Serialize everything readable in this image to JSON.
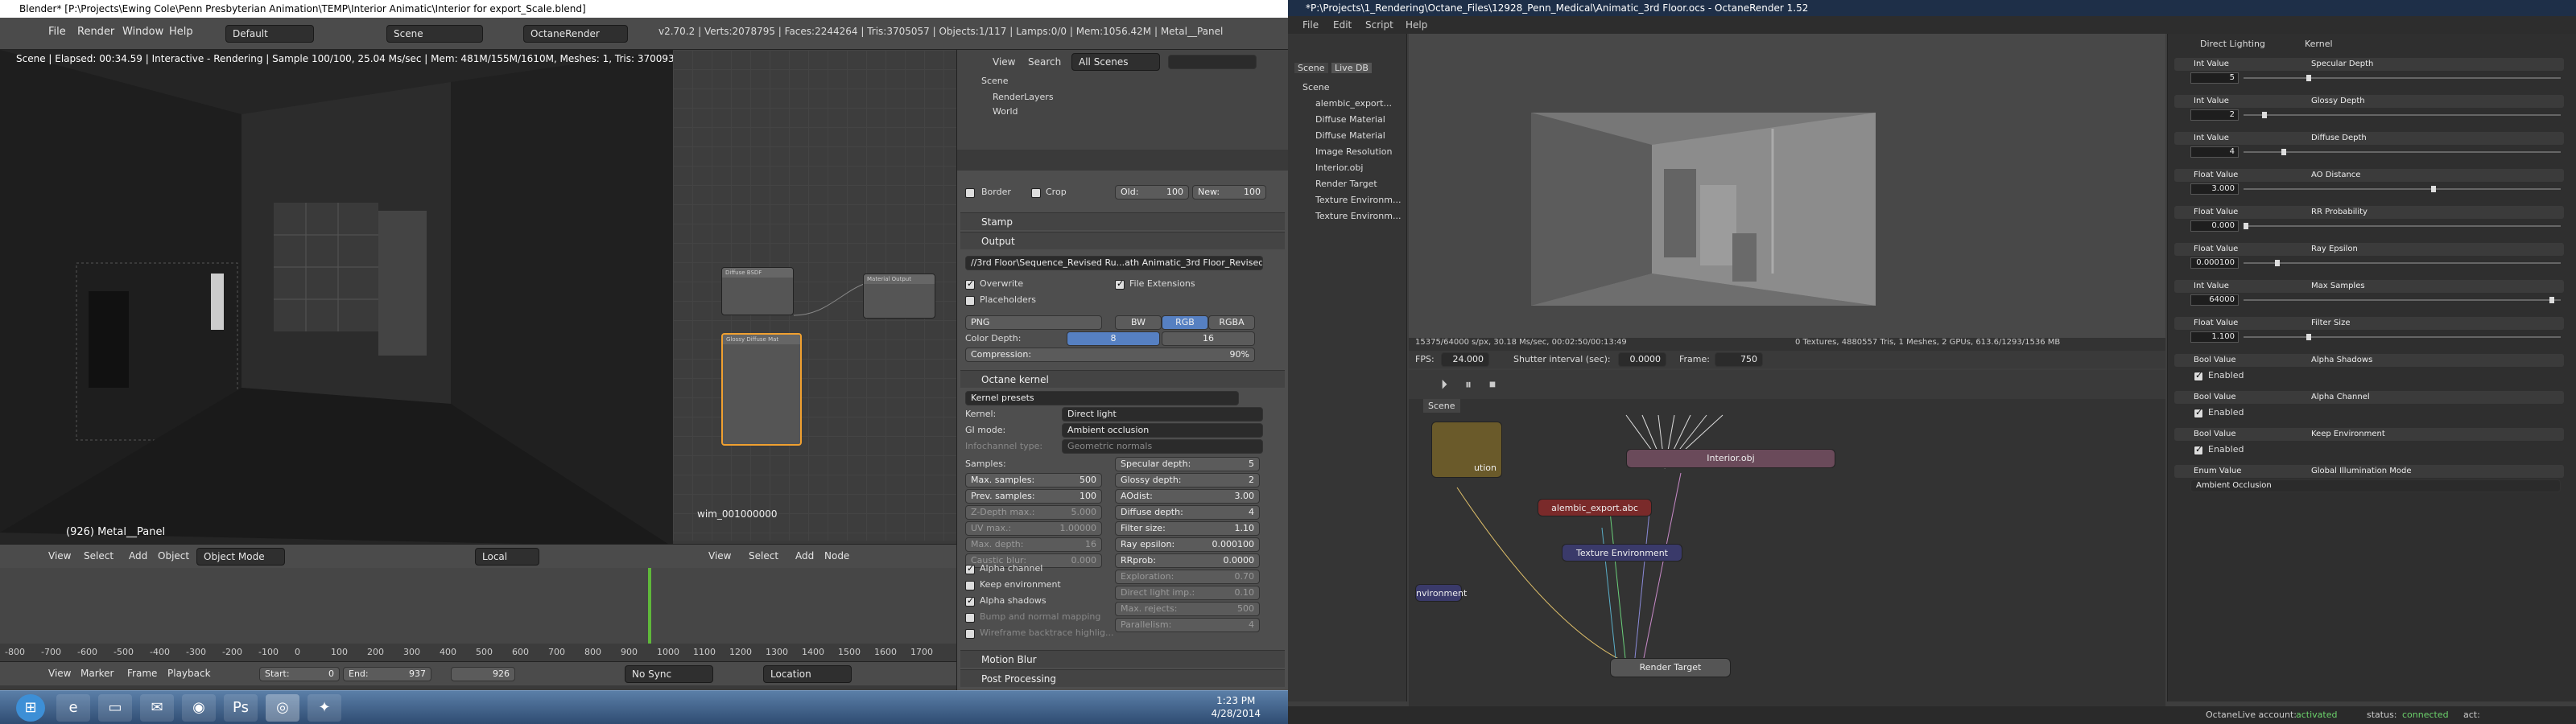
{
  "blender": {
    "title": "Blender* [P:\\Projects\\Ewing Cole\\Penn Presbyterian Animation\\TEMP\\Interior Animatic\\Interior for export_Scale.blend]",
    "menus": [
      "File",
      "Render",
      "Window",
      "Help"
    ],
    "layout": "Default",
    "scene": "Scene",
    "engine": "OctaneRender",
    "stats": "v2.70.2 | Verts:2078795 | Faces:2244264 | Tris:3705057 | Objects:1/117 | Lamps:0/0 | Mem:1056.42M | Metal__Panel",
    "viewport": {
      "status": "Scene | Elapsed: 00:34.59 | Interactive - Rendering | Sample 100/100, 25.04 Ms/sec | Mem: 481M/155M/1610M, Meshes: 1, Tris: 3700931 | Tex: ( Rgb32: 0/4, Rg",
      "object_label": "(926) Metal__Panel",
      "menus": [
        "View",
        "Select",
        "Add",
        "Object"
      ],
      "mode": "Object Mode",
      "pivot": "Local"
    },
    "node_editor": {
      "label": "wim_001000000",
      "menus": [
        "View",
        "Select",
        "Add",
        "Node"
      ],
      "nodes": [
        "Diffuse BSDF",
        "Glossy Diffuse Mat",
        "Material Output"
      ]
    },
    "timeline": {
      "menus": [
        "View",
        "Marker",
        "Frame",
        "Playback"
      ],
      "start_label": "Start:",
      "start": "0",
      "end_label": "End:",
      "end": "937",
      "current": "926",
      "sync": "No Sync",
      "keying": "Location",
      "ticks": [
        "-800",
        "-700",
        "-600",
        "-500",
        "-400",
        "-300",
        "-200",
        "-100",
        "0",
        "100",
        "200",
        "300",
        "400",
        "500",
        "600",
        "700",
        "800",
        "900",
        "1000",
        "1100",
        "1200",
        "1300",
        "1400",
        "1500",
        "1600",
        "1700"
      ]
    },
    "outliner": {
      "menus": [
        "View",
        "Search"
      ],
      "filter": "All Scenes",
      "items": [
        "Scene",
        "RenderLayers",
        "World"
      ]
    },
    "properties": {
      "border_label": "Border",
      "crop_label": "Crop",
      "old_label": "Old:",
      "old": "100",
      "new_label": "New:",
      "new": "100",
      "stamp": "Stamp",
      "output": "Output",
      "path": "//3rd Floor\\Sequence_Revised Ru...ath Animatic_3rd Floor_Revised_",
      "overwrite": "Overwrite",
      "file_ext": "File Extensions",
      "placeholders": "Placeholders",
      "format": "PNG",
      "bw": "BW",
      "rgb": "RGB",
      "rgba": "RGBA",
      "color_depth_label": "Color Depth:",
      "depth8": "8",
      "depth16": "16",
      "compression_label": "Compression:",
      "compression": "90%",
      "octane_kernel": "Octane kernel",
      "kernel_presets": "Kernel presets",
      "kernel_label": "Kernel:",
      "kernel": "Direct light",
      "gimode_label": "GI mode:",
      "gimode": "Ambient occlusion",
      "infochannel_label": "Infochannel type:",
      "infochannel": "Geometric normals",
      "samples_label": "Samples:",
      "left_fields": [
        {
          "k": "Max. samples:",
          "v": "500"
        },
        {
          "k": "Prev. samples:",
          "v": "100"
        },
        {
          "k": "Z-Depth max.:",
          "v": "5.000"
        },
        {
          "k": "UV max.:",
          "v": "1.00000"
        },
        {
          "k": "Max. depth:",
          "v": "16"
        },
        {
          "k": "Caustic blur:",
          "v": "0.000"
        }
      ],
      "right_fields": [
        {
          "k": "Specular depth:",
          "v": "5"
        },
        {
          "k": "Glossy depth:",
          "v": "2"
        },
        {
          "k": "AOdist:",
          "v": "3.00"
        },
        {
          "k": "Diffuse depth:",
          "v": "4"
        },
        {
          "k": "Filter size:",
          "v": "1.10"
        },
        {
          "k": "Ray epsilon:",
          "v": "0.000100"
        },
        {
          "k": "RRprob:",
          "v": "0.0000"
        },
        {
          "k": "Exploration:",
          "v": "0.70"
        },
        {
          "k": "Direct light imp.:",
          "v": "0.10"
        },
        {
          "k": "Max. rejects:",
          "v": "500"
        },
        {
          "k": "Parallelism:",
          "v": "4"
        }
      ],
      "alpha_channel": "Alpha channel",
      "keep_env": "Keep environment",
      "alpha_shadows": "Alpha shadows",
      "bump": "Bump and normal mapping",
      "wireframe": "Wireframe backtrace highlig...",
      "motion_blur": "Motion Blur",
      "post_processing": "Post Processing"
    },
    "taskbar": {
      "time": "1:23 PM",
      "date": "4/28/2014",
      "icons": [
        "start-orb-icon",
        "ie-icon",
        "folder-icon",
        "outlook-icon",
        "firefox-icon",
        "photoshop-icon",
        "blender-icon",
        "octane-icon"
      ]
    }
  },
  "octane": {
    "title": "*P:\\Projects\\1_Rendering\\Octane_Files\\12928_Penn_Medical\\Animatic_3rd Floor.ocs - OctaneRender 1.52",
    "menus": [
      "File",
      "Edit",
      "Script",
      "Help"
    ],
    "outliner_tabs": [
      "Scene",
      "Live DB"
    ],
    "outliner_items": [
      "Scene",
      "alembic_export...",
      "Diffuse Material",
      "Diffuse Material",
      "Image Resolution",
      "Interior.obj",
      "Render Target",
      "Texture Environm...",
      "Texture Environm..."
    ],
    "status": "15375/64000 s/px, 30.18 Ms/sec, 00:02:50/00:13:49",
    "status_right": "0 Textures, 4880557 Tris, 1 Meshes, 2 GPUs, 613.6/1293/1536 MB",
    "fps_label": "FPS:",
    "fps": "24.000",
    "shutter_label": "Shutter interval (sec):",
    "shutter": "0.0000",
    "frame_label": "Frame:",
    "frame": "750",
    "graph_tab": "Scene",
    "graph_nodes": {
      "interior": "Interior.obj",
      "alembic": "alembic_export.abc",
      "texenv": "Texture Environment",
      "rendertarget": "Render Target",
      "resolution": "ution",
      "environment": "nvironment"
    },
    "params_header": "Direct Lighting",
    "params_kernel": "Kernel",
    "params": [
      {
        "type": "Int Value",
        "name": "Specular Depth",
        "value": "5",
        "level": 0.2
      },
      {
        "type": "Int Value",
        "name": "Glossy Depth",
        "value": "2",
        "level": 0.06
      },
      {
        "type": "Int Value",
        "name": "Diffuse Depth",
        "value": "4",
        "level": 0.12
      },
      {
        "type": "Float Value",
        "name": "AO Distance",
        "value": "3.000",
        "level": 0.6
      },
      {
        "type": "Float Value",
        "name": "RR Probability",
        "value": "0.000",
        "level": 0.0
      },
      {
        "type": "Float Value",
        "name": "Ray Epsilon",
        "value": "0.000100",
        "level": 0.1
      },
      {
        "type": "Int Value",
        "name": "Max Samples",
        "value": "64000",
        "level": 0.98
      },
      {
        "type": "Float Value",
        "name": "Filter Size",
        "value": "1.100",
        "level": 0.2
      },
      {
        "type": "Bool Value",
        "name": "Alpha Shadows",
        "value": "Enabled"
      },
      {
        "type": "Bool Value",
        "name": "Alpha Channel",
        "value": "Enabled"
      },
      {
        "type": "Bool Value",
        "name": "Keep Environment",
        "value": "Enabled"
      },
      {
        "type": "Enum Value",
        "name": "Global Illumination Mode",
        "value": "Ambient Occlusion"
      }
    ],
    "footer_account_label": "OctaneLive account:",
    "footer_account": "activated",
    "footer_status_label": "status:",
    "footer_status": "connected",
    "footer_act": "act:"
  }
}
